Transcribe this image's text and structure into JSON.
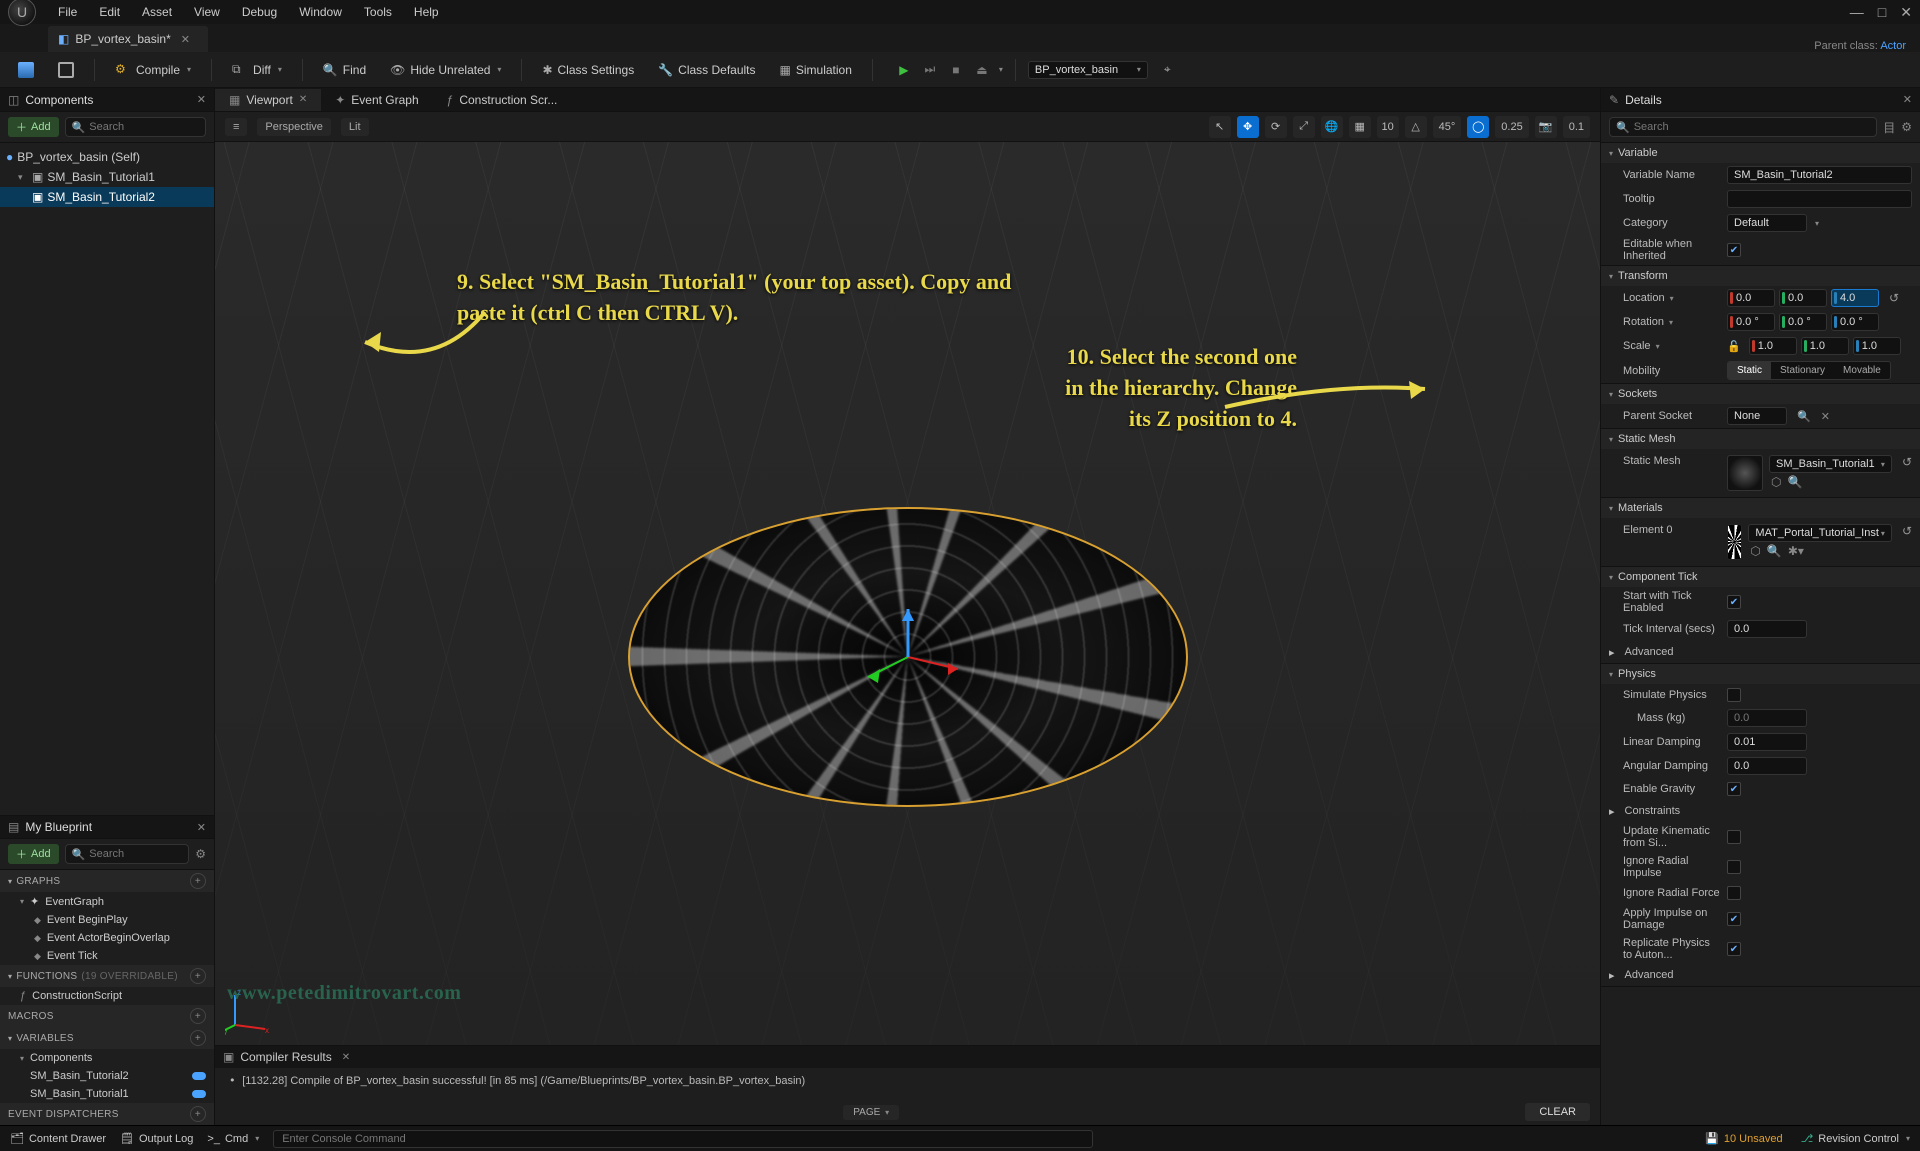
{
  "menu": [
    "File",
    "Edit",
    "Asset",
    "View",
    "Debug",
    "Window",
    "Tools",
    "Help"
  ],
  "doc_tab": {
    "title": "BP_vortex_basin*",
    "parent_label": "Parent class:",
    "parent_class": "Actor"
  },
  "toolbar": {
    "compile": "Compile",
    "diff": "Diff",
    "find": "Find",
    "hide_unrelated": "Hide Unrelated",
    "class_settings": "Class Settings",
    "class_defaults": "Class Defaults",
    "simulation": "Simulation",
    "debug_target": "BP_vortex_basin"
  },
  "components": {
    "title": "Components",
    "add": "Add",
    "search_ph": "Search",
    "tree": {
      "root": "BP_vortex_basin (Self)",
      "child1": "SM_Basin_Tutorial1",
      "child2": "SM_Basin_Tutorial2"
    }
  },
  "my_blueprint": {
    "title": "My Blueprint",
    "add": "Add",
    "search_ph": "Search",
    "graphs_hdr": "GRAPHS",
    "eventgraph": "EventGraph",
    "events": [
      "Event BeginPlay",
      "Event ActorBeginOverlap",
      "Event Tick"
    ],
    "functions_hdr": "FUNCTIONS",
    "functions_note": "(19 OVERRIDABLE)",
    "construction_script": "ConstructionScript",
    "macros_hdr": "MACROS",
    "variables_hdr": "VARIABLES",
    "components_hdr": "Components",
    "vars": [
      "SM_Basin_Tutorial2",
      "SM_Basin_Tutorial1"
    ],
    "dispatchers_hdr": "EVENT DISPATCHERS"
  },
  "center_tabs": {
    "viewport": "Viewport",
    "eventgraph": "Event Graph",
    "construction": "Construction Scr..."
  },
  "viewport_bar": {
    "perspective": "Perspective",
    "lit": "Lit",
    "grid_snap": "10",
    "angle_snap": "45°",
    "scale_snap": "0.25",
    "cam_speed": "0.1"
  },
  "annotations": {
    "a1": "9. Select \"SM_Basin_Tutorial1\" (your top asset). Copy and paste it (ctrl C then CTRL V).",
    "a2": "10. Select the second one in the hierarchy. Change its Z position to 4."
  },
  "watermark": "www.petedimitrovart.com",
  "compiler": {
    "title": "Compiler Results",
    "line": "[1132.28] Compile of BP_vortex_basin successful! [in 85 ms] (/Game/Blueprints/BP_vortex_basin.BP_vortex_basin)",
    "page": "PAGE",
    "clear": "CLEAR"
  },
  "details": {
    "title": "Details",
    "search_ph": "Search",
    "sections": {
      "variable": {
        "hdr": "Variable",
        "name_lbl": "Variable Name",
        "name_val": "SM_Basin_Tutorial2",
        "tooltip_lbl": "Tooltip",
        "tooltip_val": "",
        "category_lbl": "Category",
        "category_val": "Default",
        "editable_lbl": "Editable when Inherited",
        "editable_val": true
      },
      "transform": {
        "hdr": "Transform",
        "location_lbl": "Location",
        "location": [
          "0.0",
          "0.0",
          "4.0"
        ],
        "rotation_lbl": "Rotation",
        "rotation": [
          "0.0 °",
          "0.0 °",
          "0.0 °"
        ],
        "scale_lbl": "Scale",
        "scale": [
          "1.0",
          "1.0",
          "1.0"
        ],
        "mobility_lbl": "Mobility",
        "mobility": [
          "Static",
          "Stationary",
          "Movable"
        ]
      },
      "sockets": {
        "hdr": "Sockets",
        "parent_lbl": "Parent Socket",
        "parent_val": "None"
      },
      "static_mesh": {
        "hdr": "Static Mesh",
        "lbl": "Static Mesh",
        "val": "SM_Basin_Tutorial1"
      },
      "materials": {
        "hdr": "Materials",
        "el0_lbl": "Element 0",
        "el0_val": "MAT_Portal_Tutorial_Inst"
      },
      "component_tick": {
        "hdr": "Component Tick",
        "start_lbl": "Start with Tick Enabled",
        "start_val": true,
        "interval_lbl": "Tick Interval (secs)",
        "interval_val": "0.0",
        "advanced": "Advanced"
      },
      "physics": {
        "hdr": "Physics",
        "simulate_lbl": "Simulate Physics",
        "simulate_val": false,
        "mass_lbl": "Mass (kg)",
        "mass_val": "0.0",
        "linear_lbl": "Linear Damping",
        "linear_val": "0.01",
        "angular_lbl": "Angular Damping",
        "angular_val": "0.0",
        "gravity_lbl": "Enable Gravity",
        "gravity_val": true,
        "constraints_lbl": "Constraints",
        "kinematic_lbl": "Update Kinematic from Si...",
        "ignore_impulse_lbl": "Ignore Radial Impulse",
        "ignore_force_lbl": "Ignore Radial Force",
        "apply_impulse_lbl": "Apply Impulse on Damage",
        "apply_impulse_val": true,
        "replicate_lbl": "Replicate Physics to Auton...",
        "replicate_val": true,
        "advanced": "Advanced"
      }
    }
  },
  "status": {
    "content_drawer": "Content Drawer",
    "output_log": "Output Log",
    "cmd_label": "Cmd",
    "cmd_ph": "Enter Console Command",
    "unsaved": "10 Unsaved",
    "revision": "Revision Control"
  }
}
